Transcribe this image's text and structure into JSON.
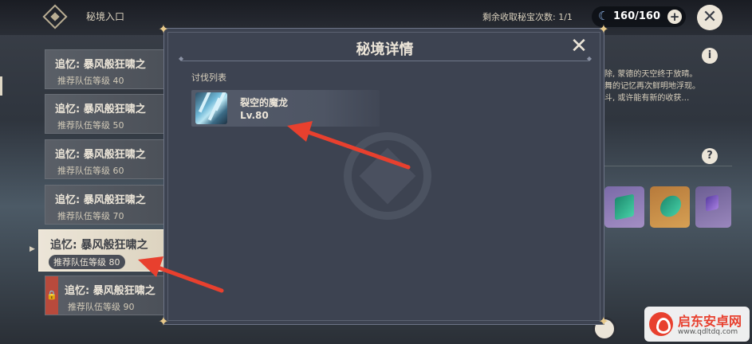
{
  "header": {
    "nav_title": "秘境入口",
    "remaining_label": "剩余收取秘宝次数: 1/1",
    "resin_value": "160/160"
  },
  "domain_list": {
    "items": [
      {
        "name": "追忆: 暴风般狂啸之",
        "level": "推荐队伍等级 40",
        "state": "normal"
      },
      {
        "name": "追忆: 暴风般狂啸之",
        "level": "推荐队伍等级 50",
        "state": "normal"
      },
      {
        "name": "追忆: 暴风般狂啸之",
        "level": "推荐队伍等级 60",
        "state": "normal"
      },
      {
        "name": "追忆: 暴风般狂啸之",
        "level": "推荐队伍等级 70",
        "state": "normal"
      },
      {
        "name": "追忆: 暴风般狂啸之",
        "level": "推荐队伍等级 80",
        "state": "selected"
      },
      {
        "name": "追忆: 暴风般狂啸之",
        "level": "推荐队伍等级 90",
        "state": "locked"
      }
    ]
  },
  "right_panel": {
    "desc_lines": [
      "除, 蒙德的天空终于放晴。",
      "舞的记忆再次鲜明地浮现。",
      "斗, 或许能有新的收获…"
    ],
    "rewards": [
      "green-crystal",
      "green-orb",
      "purple-item"
    ]
  },
  "modal": {
    "title": "秘境详情",
    "section_label": "讨伐列表",
    "enemies": [
      {
        "name": "裂空的魔龙",
        "level": "Lv.80"
      }
    ]
  },
  "watermark": {
    "title": "启东安卓网",
    "url": "www.qdltdq.com"
  },
  "colors": {
    "accent_red": "#e8402e",
    "text_cream": "#ece5d8",
    "modal_bg": "#3d4351"
  }
}
